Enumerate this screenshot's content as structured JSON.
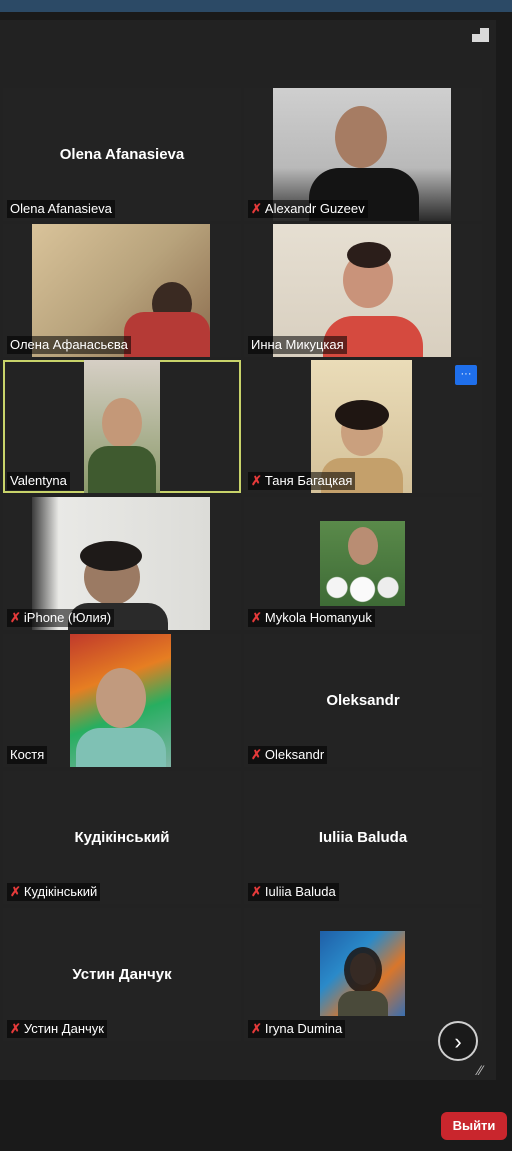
{
  "participants": [
    {
      "name": "Olena Afanasieva",
      "center_name": "Olena Afanasieva",
      "muted": false
    },
    {
      "name": "Alexandr Guzeev",
      "muted": true
    },
    {
      "name": "Олена Афанасьєва",
      "muted": false
    },
    {
      "name": "Инна Микуцкая",
      "muted": false
    },
    {
      "name": "Valentyna",
      "muted": false,
      "active_speaker": true
    },
    {
      "name": "Таня Багацкая",
      "muted": true
    },
    {
      "name": "iPhone (Юлия)",
      "muted": true
    },
    {
      "name": "Mykola Homanyuk",
      "muted": true
    },
    {
      "name": "Костя",
      "muted": false
    },
    {
      "name": "Oleksandr",
      "center_name": "Oleksandr",
      "muted": true
    },
    {
      "name": "Кудікінський",
      "center_name": "Кудікінський",
      "muted": true
    },
    {
      "name": "Iuliia Baluda",
      "center_name": "Iuliia Baluda",
      "muted": true
    },
    {
      "name": "Устин Данчук",
      "center_name": "Устин Данчук",
      "muted": true
    },
    {
      "name": "Iryna Dumina",
      "muted": true
    }
  ],
  "controls": {
    "more_label": "···",
    "next_page_icon": "chevron-right-icon",
    "leave_label": "Выйти"
  },
  "colors": {
    "accent_blue": "#1f6feb",
    "leave_red": "#c9262d",
    "active_outline": "#c8d36a",
    "muted_icon": "#e53a3a"
  }
}
